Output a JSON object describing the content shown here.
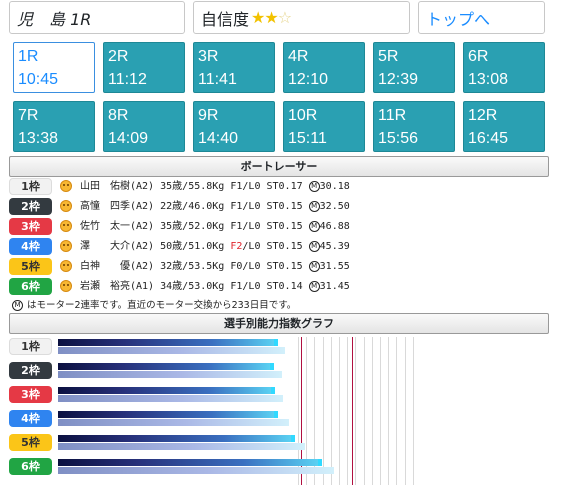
{
  "header": {
    "venue": "児　島 1R",
    "confidence_label": "自信度",
    "confidence_stars": "★★",
    "confidence_stars_off": "☆",
    "top_link": "トップへ"
  },
  "races": [
    {
      "no": "1R",
      "time": "10:45",
      "active": true
    },
    {
      "no": "2R",
      "time": "11:12"
    },
    {
      "no": "3R",
      "time": "11:41"
    },
    {
      "no": "4R",
      "time": "12:10"
    },
    {
      "no": "5R",
      "time": "12:39"
    },
    {
      "no": "6R",
      "time": "13:08"
    },
    {
      "no": "7R",
      "time": "13:38"
    },
    {
      "no": "8R",
      "time": "14:09"
    },
    {
      "no": "9R",
      "time": "14:40"
    },
    {
      "no": "10R",
      "time": "15:11"
    },
    {
      "no": "11R",
      "time": "15:56"
    },
    {
      "no": "12R",
      "time": "16:45"
    }
  ],
  "racer_section_title": "ボートレーサー",
  "racers": [
    {
      "waku": "1枠",
      "name": "山田　佑樹",
      "cls": "(A2)",
      "age": "35歳",
      "weight": "55.8Kg",
      "f": "F1",
      "l": "/L0",
      "st": "ST0.17",
      "motor": "30.18"
    },
    {
      "waku": "2枠",
      "name": "高憧　四季",
      "cls": "(A2)",
      "age": "22歳",
      "weight": "46.0Kg",
      "f": "F1",
      "l": "/L0",
      "st": "ST0.15",
      "motor": "32.50"
    },
    {
      "waku": "3枠",
      "name": "佐竹　太一",
      "cls": "(A2)",
      "age": "35歳",
      "weight": "52.0Kg",
      "f": "F1",
      "l": "/L0",
      "st": "ST0.15",
      "motor": "46.88"
    },
    {
      "waku": "4枠",
      "name": "澤　　大介",
      "cls": "(A2)",
      "age": "50歳",
      "weight": "51.0Kg",
      "f": "F2",
      "l": "/L0",
      "st": "ST0.15",
      "motor": "45.39",
      "f_red": true
    },
    {
      "waku": "5枠",
      "name": "白神　　優",
      "cls": "(A2)",
      "age": "32歳",
      "weight": "53.5Kg",
      "f": "F0",
      "l": "/L0",
      "st": "ST0.15",
      "motor": "31.55"
    },
    {
      "waku": "6枠",
      "name": "岩瀬　裕亮",
      "cls": "(A1)",
      "age": "34歳",
      "weight": "53.0Kg",
      "f": "F1",
      "l": "/L0",
      "st": "ST0.14",
      "motor": "31.45"
    }
  ],
  "motor_symbol": "M",
  "motor_note": "はモーター2連率です。直近のモーター交換から233日目です。",
  "graph_title": "選手別能力指数グラフ",
  "graph": {
    "labels": [
      "1枠",
      "2枠",
      "3枠",
      "4枠",
      "5枠",
      "6枠"
    ],
    "primary": [
      0.905,
      0.89,
      0.895,
      0.905,
      0.975,
      1.085
    ],
    "secondary": [
      0.935,
      0.92,
      0.925,
      0.95,
      1.015,
      1.135
    ],
    "colors": {
      "primary_end": "#31d9ff",
      "secondary_end": "#d2f0fb",
      "marker_red": "#b01040"
    }
  }
}
